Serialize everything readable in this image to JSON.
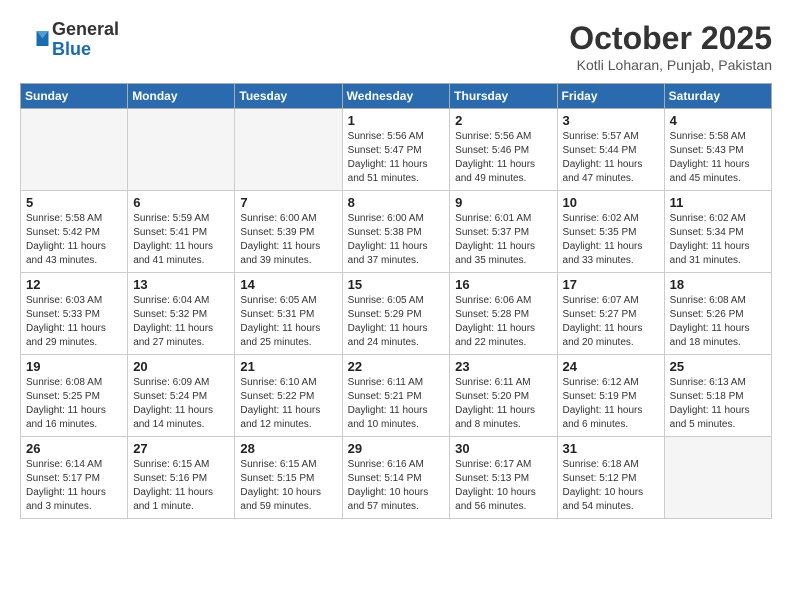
{
  "header": {
    "logo_general": "General",
    "logo_blue": "Blue",
    "month": "October 2025",
    "location": "Kotli Loharan, Punjab, Pakistan"
  },
  "weekdays": [
    "Sunday",
    "Monday",
    "Tuesday",
    "Wednesday",
    "Thursday",
    "Friday",
    "Saturday"
  ],
  "weeks": [
    [
      {
        "day": "",
        "info": ""
      },
      {
        "day": "",
        "info": ""
      },
      {
        "day": "",
        "info": ""
      },
      {
        "day": "1",
        "info": "Sunrise: 5:56 AM\nSunset: 5:47 PM\nDaylight: 11 hours\nand 51 minutes."
      },
      {
        "day": "2",
        "info": "Sunrise: 5:56 AM\nSunset: 5:46 PM\nDaylight: 11 hours\nand 49 minutes."
      },
      {
        "day": "3",
        "info": "Sunrise: 5:57 AM\nSunset: 5:44 PM\nDaylight: 11 hours\nand 47 minutes."
      },
      {
        "day": "4",
        "info": "Sunrise: 5:58 AM\nSunset: 5:43 PM\nDaylight: 11 hours\nand 45 minutes."
      }
    ],
    [
      {
        "day": "5",
        "info": "Sunrise: 5:58 AM\nSunset: 5:42 PM\nDaylight: 11 hours\nand 43 minutes."
      },
      {
        "day": "6",
        "info": "Sunrise: 5:59 AM\nSunset: 5:41 PM\nDaylight: 11 hours\nand 41 minutes."
      },
      {
        "day": "7",
        "info": "Sunrise: 6:00 AM\nSunset: 5:39 PM\nDaylight: 11 hours\nand 39 minutes."
      },
      {
        "day": "8",
        "info": "Sunrise: 6:00 AM\nSunset: 5:38 PM\nDaylight: 11 hours\nand 37 minutes."
      },
      {
        "day": "9",
        "info": "Sunrise: 6:01 AM\nSunset: 5:37 PM\nDaylight: 11 hours\nand 35 minutes."
      },
      {
        "day": "10",
        "info": "Sunrise: 6:02 AM\nSunset: 5:35 PM\nDaylight: 11 hours\nand 33 minutes."
      },
      {
        "day": "11",
        "info": "Sunrise: 6:02 AM\nSunset: 5:34 PM\nDaylight: 11 hours\nand 31 minutes."
      }
    ],
    [
      {
        "day": "12",
        "info": "Sunrise: 6:03 AM\nSunset: 5:33 PM\nDaylight: 11 hours\nand 29 minutes."
      },
      {
        "day": "13",
        "info": "Sunrise: 6:04 AM\nSunset: 5:32 PM\nDaylight: 11 hours\nand 27 minutes."
      },
      {
        "day": "14",
        "info": "Sunrise: 6:05 AM\nSunset: 5:31 PM\nDaylight: 11 hours\nand 25 minutes."
      },
      {
        "day": "15",
        "info": "Sunrise: 6:05 AM\nSunset: 5:29 PM\nDaylight: 11 hours\nand 24 minutes."
      },
      {
        "day": "16",
        "info": "Sunrise: 6:06 AM\nSunset: 5:28 PM\nDaylight: 11 hours\nand 22 minutes."
      },
      {
        "day": "17",
        "info": "Sunrise: 6:07 AM\nSunset: 5:27 PM\nDaylight: 11 hours\nand 20 minutes."
      },
      {
        "day": "18",
        "info": "Sunrise: 6:08 AM\nSunset: 5:26 PM\nDaylight: 11 hours\nand 18 minutes."
      }
    ],
    [
      {
        "day": "19",
        "info": "Sunrise: 6:08 AM\nSunset: 5:25 PM\nDaylight: 11 hours\nand 16 minutes."
      },
      {
        "day": "20",
        "info": "Sunrise: 6:09 AM\nSunset: 5:24 PM\nDaylight: 11 hours\nand 14 minutes."
      },
      {
        "day": "21",
        "info": "Sunrise: 6:10 AM\nSunset: 5:22 PM\nDaylight: 11 hours\nand 12 minutes."
      },
      {
        "day": "22",
        "info": "Sunrise: 6:11 AM\nSunset: 5:21 PM\nDaylight: 11 hours\nand 10 minutes."
      },
      {
        "day": "23",
        "info": "Sunrise: 6:11 AM\nSunset: 5:20 PM\nDaylight: 11 hours\nand 8 minutes."
      },
      {
        "day": "24",
        "info": "Sunrise: 6:12 AM\nSunset: 5:19 PM\nDaylight: 11 hours\nand 6 minutes."
      },
      {
        "day": "25",
        "info": "Sunrise: 6:13 AM\nSunset: 5:18 PM\nDaylight: 11 hours\nand 5 minutes."
      }
    ],
    [
      {
        "day": "26",
        "info": "Sunrise: 6:14 AM\nSunset: 5:17 PM\nDaylight: 11 hours\nand 3 minutes."
      },
      {
        "day": "27",
        "info": "Sunrise: 6:15 AM\nSunset: 5:16 PM\nDaylight: 11 hours\nand 1 minute."
      },
      {
        "day": "28",
        "info": "Sunrise: 6:15 AM\nSunset: 5:15 PM\nDaylight: 10 hours\nand 59 minutes."
      },
      {
        "day": "29",
        "info": "Sunrise: 6:16 AM\nSunset: 5:14 PM\nDaylight: 10 hours\nand 57 minutes."
      },
      {
        "day": "30",
        "info": "Sunrise: 6:17 AM\nSunset: 5:13 PM\nDaylight: 10 hours\nand 56 minutes."
      },
      {
        "day": "31",
        "info": "Sunrise: 6:18 AM\nSunset: 5:12 PM\nDaylight: 10 hours\nand 54 minutes."
      },
      {
        "day": "",
        "info": ""
      }
    ]
  ]
}
